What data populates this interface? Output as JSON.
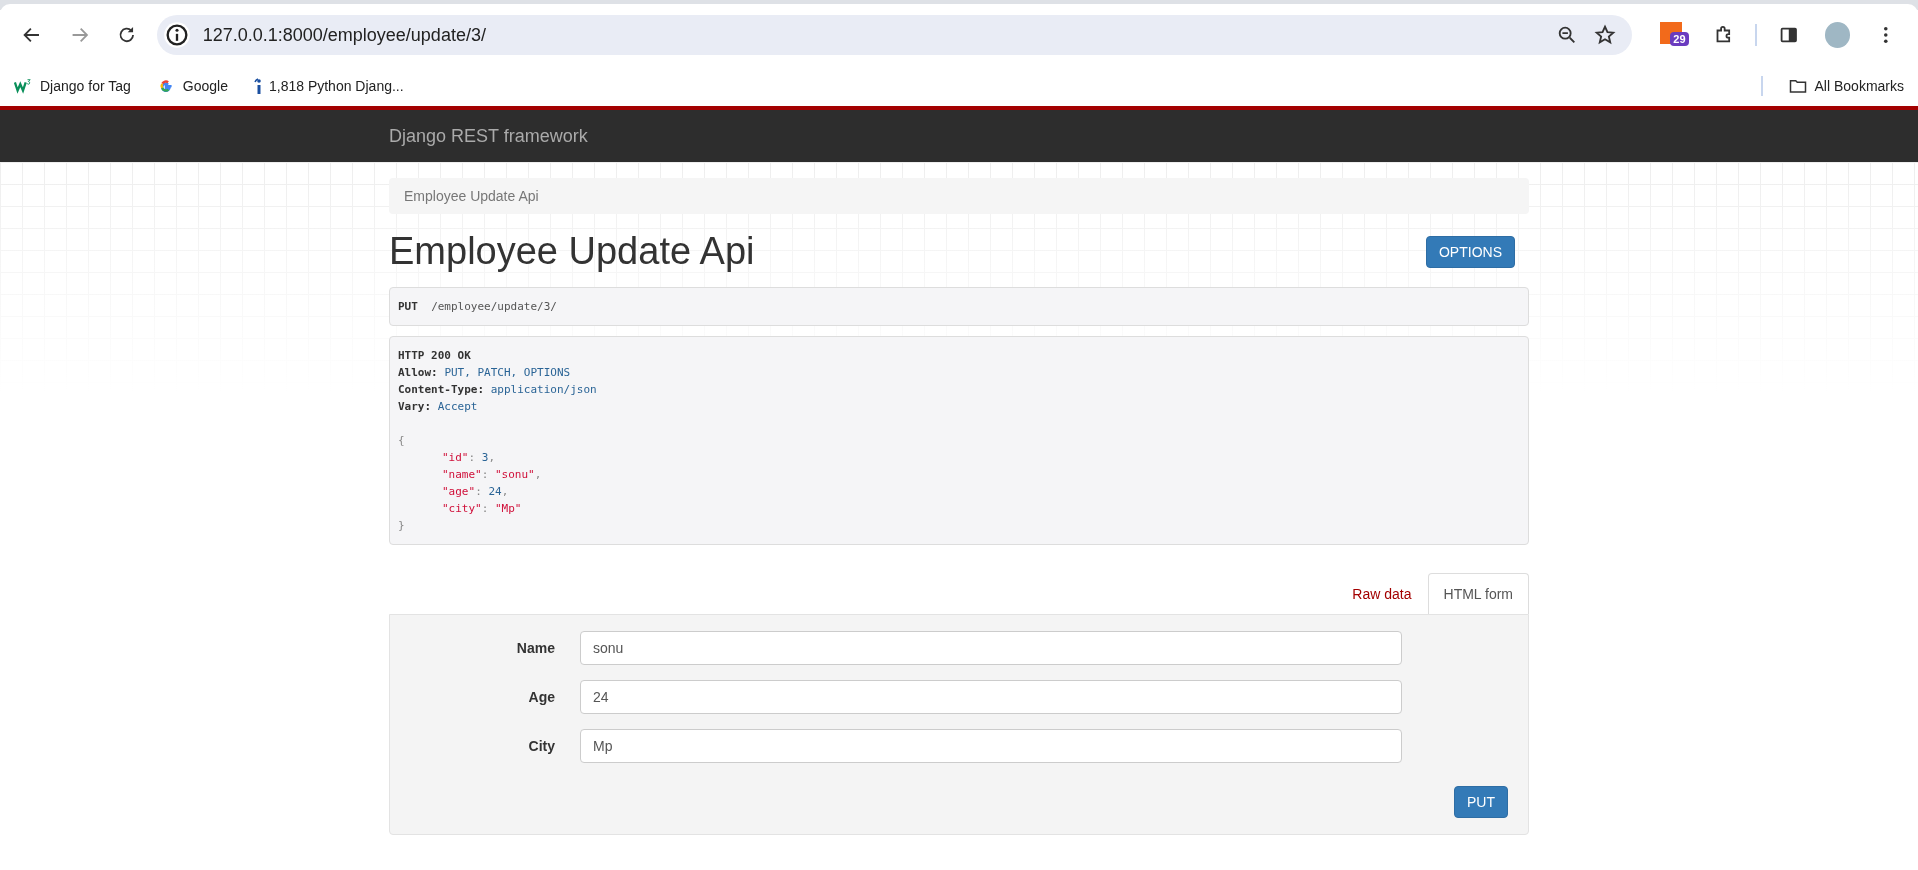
{
  "browser": {
    "url": "127.0.0.1:8000/employee/update/3/",
    "extension_badge": "29",
    "bookmarks": [
      {
        "label": "Django for Tag",
        "kind": "w3"
      },
      {
        "label": "Google",
        "kind": "google"
      },
      {
        "label": "1,818 Python Djang...",
        "kind": "info"
      }
    ],
    "all_bookmarks": "All Bookmarks"
  },
  "navbar": {
    "brand": "Django REST framework"
  },
  "breadcrumb": [
    "Employee Update Api"
  ],
  "title": "Employee Update Api",
  "options_button": "OPTIONS",
  "request": {
    "method": "PUT",
    "path": "/employee/update/3/"
  },
  "response": {
    "status": "HTTP 200 OK",
    "headers": [
      {
        "name": "Allow:",
        "value": "PUT, PATCH, OPTIONS"
      },
      {
        "name": "Content-Type:",
        "value": "application/json"
      },
      {
        "name": "Vary:",
        "value": "Accept"
      }
    ],
    "open": "{",
    "fields": [
      {
        "key": "\"id\"",
        "colon": ":",
        "value": "3",
        "kind": "number",
        "trail": ","
      },
      {
        "key": "\"name\"",
        "colon": ":",
        "value": "\"sonu\"",
        "kind": "string",
        "trail": ","
      },
      {
        "key": "\"age\"",
        "colon": ":",
        "value": "24",
        "kind": "number",
        "trail": ","
      },
      {
        "key": "\"city\"",
        "colon": ":",
        "value": "\"Mp\"",
        "kind": "string"
      }
    ],
    "close": "}"
  },
  "tabs": [
    {
      "label": "Raw data",
      "selected": false
    },
    {
      "label": "HTML form",
      "selected": true
    }
  ],
  "form": {
    "fields": [
      {
        "label": "Name",
        "value": "sonu"
      },
      {
        "label": "Age",
        "value": "24"
      },
      {
        "label": "City",
        "value": "Mp"
      }
    ],
    "submit": "PUT"
  }
}
